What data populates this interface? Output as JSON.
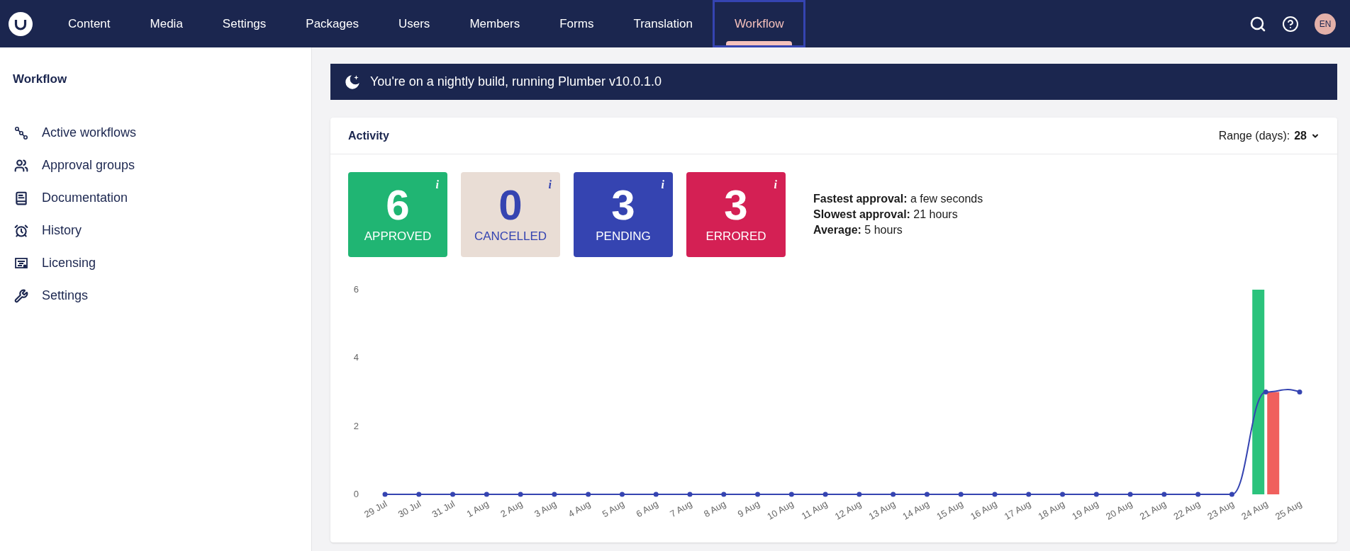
{
  "nav": {
    "items": [
      {
        "label": "Content",
        "selected": false
      },
      {
        "label": "Media",
        "selected": false
      },
      {
        "label": "Settings",
        "selected": false
      },
      {
        "label": "Packages",
        "selected": false
      },
      {
        "label": "Users",
        "selected": false
      },
      {
        "label": "Members",
        "selected": false
      },
      {
        "label": "Forms",
        "selected": false
      },
      {
        "label": "Translation",
        "selected": false
      },
      {
        "label": "Workflow",
        "selected": true
      }
    ],
    "avatar": "EN"
  },
  "sidebar": {
    "title": "Workflow",
    "items": [
      {
        "label": "Active workflows"
      },
      {
        "label": "Approval groups"
      },
      {
        "label": "Documentation"
      },
      {
        "label": "History"
      },
      {
        "label": "Licensing"
      },
      {
        "label": "Settings"
      }
    ]
  },
  "banner": {
    "text": "You're on a nightly build, running Plumber v10.0.1.0"
  },
  "activity": {
    "title": "Activity",
    "range": {
      "label": "Range (days):",
      "value": "28"
    },
    "stats": [
      {
        "kind": "solid",
        "value": "6",
        "label": "APPROVED",
        "info": "i",
        "color": "#20b573"
      },
      {
        "kind": "pale",
        "value": "0",
        "label": "CANCELLED",
        "info": "i",
        "color": "#e9ddd5"
      },
      {
        "kind": "solid",
        "value": "3",
        "label": "PENDING",
        "info": "i",
        "color": "#3544b1"
      },
      {
        "kind": "solid",
        "value": "3",
        "label": "ERRORED",
        "info": "i",
        "color": "#d42054"
      }
    ],
    "summary": [
      "**Fastest approval:** a few seconds",
      "**Slowest approval:** 21 hours",
      "**Average:** 5 hours"
    ],
    "chart_data": {
      "type": "bar",
      "categories": [
        "29 Jul",
        "30 Jul",
        "31 Jul",
        "1 Aug",
        "2 Aug",
        "3 Aug",
        "4 Aug",
        "5 Aug",
        "6 Aug",
        "7 Aug",
        "8 Aug",
        "9 Aug",
        "10 Aug",
        "11 Aug",
        "12 Aug",
        "13 Aug",
        "14 Aug",
        "15 Aug",
        "16 Aug",
        "17 Aug",
        "18 Aug",
        "19 Aug",
        "20 Aug",
        "21 Aug",
        "22 Aug",
        "23 Aug",
        "24 Aug",
        "25 Aug"
      ],
      "ylim": [
        0,
        6
      ],
      "yticks": [
        0,
        2,
        4,
        6
      ],
      "series": [
        {
          "color": "#2bc37c",
          "values": [
            0,
            0,
            0,
            0,
            0,
            0,
            0,
            0,
            0,
            0,
            0,
            0,
            0,
            0,
            0,
            0,
            0,
            0,
            0,
            0,
            0,
            0,
            0,
            0,
            0,
            0,
            6,
            null
          ]
        },
        {
          "color": "#f0605d",
          "values": [
            0,
            0,
            0,
            0,
            0,
            0,
            0,
            0,
            0,
            0,
            0,
            0,
            0,
            0,
            0,
            0,
            0,
            0,
            0,
            0,
            0,
            0,
            0,
            0,
            0,
            0,
            3,
            null
          ]
        },
        {
          "type": "line",
          "marker": true,
          "color": "#3544b1",
          "values": [
            0,
            0,
            0,
            0,
            0,
            0,
            0,
            0,
            0,
            0,
            0,
            0,
            0,
            0,
            0,
            0,
            0,
            0,
            0,
            0,
            0,
            0,
            0,
            0,
            0,
            0,
            3,
            3
          ]
        }
      ]
    }
  }
}
